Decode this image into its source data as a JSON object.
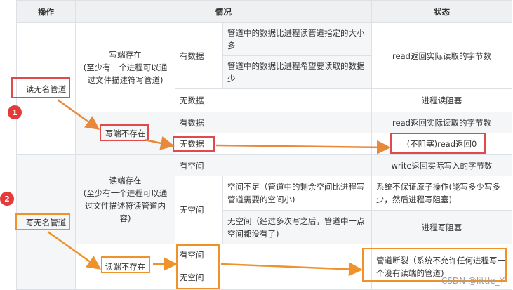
{
  "headers": {
    "operation": "操作",
    "situation": "情况",
    "status": "状态"
  },
  "read_nameless": {
    "op": "读无名管道",
    "writer_exists": "写端存在\n(至少有一个进程可以通过文件描述符写管道)",
    "has_data": "有数据",
    "case_bigger": "管道中的数据比进程读管道指定的大小多",
    "case_smaller": "管道中的数据比进程希望要读取的数据少",
    "status_read_actual": "read返回实际读取的字节数",
    "no_data": "无数据",
    "status_blocked": "进程读阻塞",
    "writer_absent": "写端不存在",
    "has_data2": "有数据",
    "status_read_actual2": "read返回实际读取的字节数",
    "no_data2": "无数据",
    "status_return0": "(不阻塞)read返回0"
  },
  "write_nameless": {
    "op": "写无名管道",
    "reader_exists": "读端存在\n(至少有一个进程可以通过文件描述符读管道内容)",
    "has_space": "有空间",
    "status_write_actual": "write返回实际写入的字节数",
    "no_space": "无空间",
    "case_insufficient": "空间不足（管道中的剩余空间比进程写管道需要的空间小)",
    "status_not_atomic": "系统不保证原子操作(能写多少写多少，然后进程写阻塞)",
    "case_none": "无空间（经过多次写之后，管道中一点空间都没有了)",
    "status_write_blocked": "进程写阻塞",
    "reader_absent": "读端不存在",
    "has_space2": "有空间",
    "no_space2": "无空间",
    "status_broken": "管道断裂（系统不允许任何进程写一个没有读端的管道)"
  },
  "badges": [
    "1",
    "2"
  ],
  "watermark": "CSDN @little_Y",
  "colors": {
    "highlight_red": "#e04a4a",
    "highlight_orange": "#f0922a",
    "badge": "#e43a3a"
  }
}
